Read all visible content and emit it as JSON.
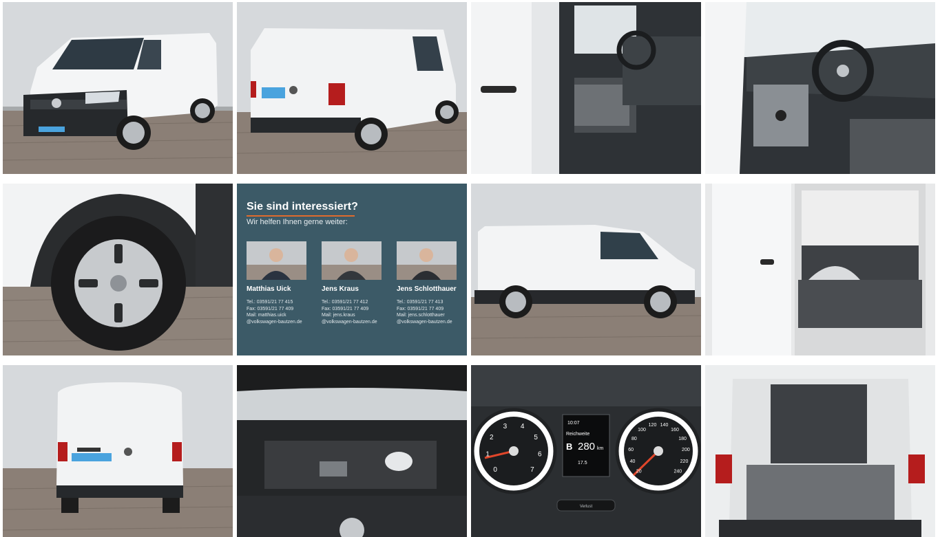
{
  "gallery": {
    "tiles": [
      {
        "alt": "Front left exterior view"
      },
      {
        "alt": "Rear left exterior view"
      },
      {
        "alt": "Driver door and seats"
      },
      {
        "alt": "Dashboard and steering wheel"
      },
      {
        "alt": "Wheel detail"
      },
      {
        "alt": "Contact card"
      },
      {
        "alt": "Side profile view"
      },
      {
        "alt": "Sliding door open, cargo area"
      },
      {
        "alt": "Rear view"
      },
      {
        "alt": "Engine bay"
      },
      {
        "alt": "Instrument cluster"
      },
      {
        "alt": "Rear doors open, cargo area"
      }
    ]
  },
  "contact": {
    "title": "Sie sind interessiert?",
    "subtitle": "Wir helfen Ihnen gerne weiter:",
    "people": [
      {
        "name": "Matthias Uick",
        "tel": "Tel.:  03591/21 77 415",
        "fax": "Fax:  03591/21 77 409",
        "mail": "Mail:  matthias.uick",
        "domain": "@volkswagen-bautzen.de"
      },
      {
        "name": "Jens Kraus",
        "tel": "Tel.:    03591/21 77 412",
        "fax": "Fax:    03591/21 77 409",
        "mail": "Mail:    jens.kraus",
        "domain": "@volkswagen-bautzen.de"
      },
      {
        "name": "Jens Schlotthauer",
        "tel": "Tel.:  03591/21 77 413",
        "fax": "Fax:  03591/21 77 409",
        "mail": "Mail: jens.schlotthauer",
        "domain": "@volkswagen-bautzen.de"
      }
    ]
  },
  "cluster": {
    "time": "10:07",
    "label": "Reichweite",
    "range": "280",
    "range_prefix": "B",
    "unit": "km",
    "temp": "17.5",
    "button": "Verlust",
    "left_ticks": [
      "0",
      "1",
      "2",
      "3",
      "4",
      "5",
      "6",
      "7"
    ],
    "right_ticks": [
      "20",
      "40",
      "60",
      "80",
      "100",
      "120",
      "140",
      "160",
      "180",
      "200",
      "220",
      "240"
    ]
  },
  "colors": {
    "card_bg": "#3c5a67",
    "accent": "#e06b2d"
  }
}
